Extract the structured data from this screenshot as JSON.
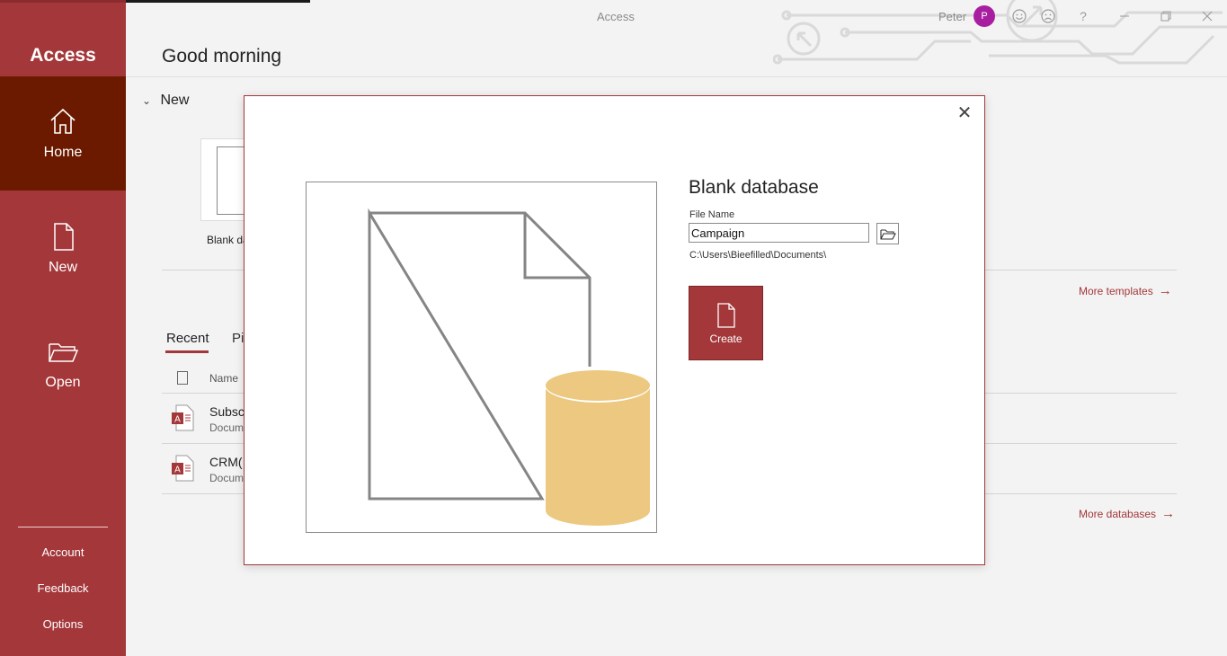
{
  "app": {
    "name": "Access",
    "window_title": "Access",
    "greeting": "Good morning",
    "user_name": "Peter",
    "user_initial": "P"
  },
  "sidebar": {
    "items": [
      {
        "label": "Home",
        "icon": "home-icon",
        "active": true
      },
      {
        "label": "New",
        "icon": "new-document-icon",
        "active": false
      },
      {
        "label": "Open",
        "icon": "folder-open-icon",
        "active": false
      }
    ],
    "bottom_links": [
      "Account",
      "Feedback",
      "Options"
    ]
  },
  "titlebar": {
    "icons": [
      "smiley-icon",
      "frown-icon",
      "help-icon",
      "minimize-icon",
      "restore-icon",
      "close-icon"
    ],
    "help_glyph": "?"
  },
  "main": {
    "new_section_label": "New",
    "blank_tile_caption": "Blank da",
    "more_templates": "More templates",
    "tabs": [
      "Recent",
      "Pi"
    ],
    "name_column": "Name",
    "recent_files": [
      {
        "name": "Subsc",
        "location": "Docum"
      },
      {
        "name": "CRM(",
        "location": "Docum"
      }
    ],
    "more_databases": "More databases"
  },
  "dialog": {
    "title": "Blank database",
    "file_name_label": "File Name",
    "file_name_value": "Campaign",
    "path": "C:\\Users\\Bieefilled\\Documents\\",
    "create_label": "Create"
  },
  "colors": {
    "accent": "#a4373a",
    "sidebar_active": "#6b1a00",
    "database_cylinder": "#ecc880",
    "avatar": "#a71fa0"
  }
}
